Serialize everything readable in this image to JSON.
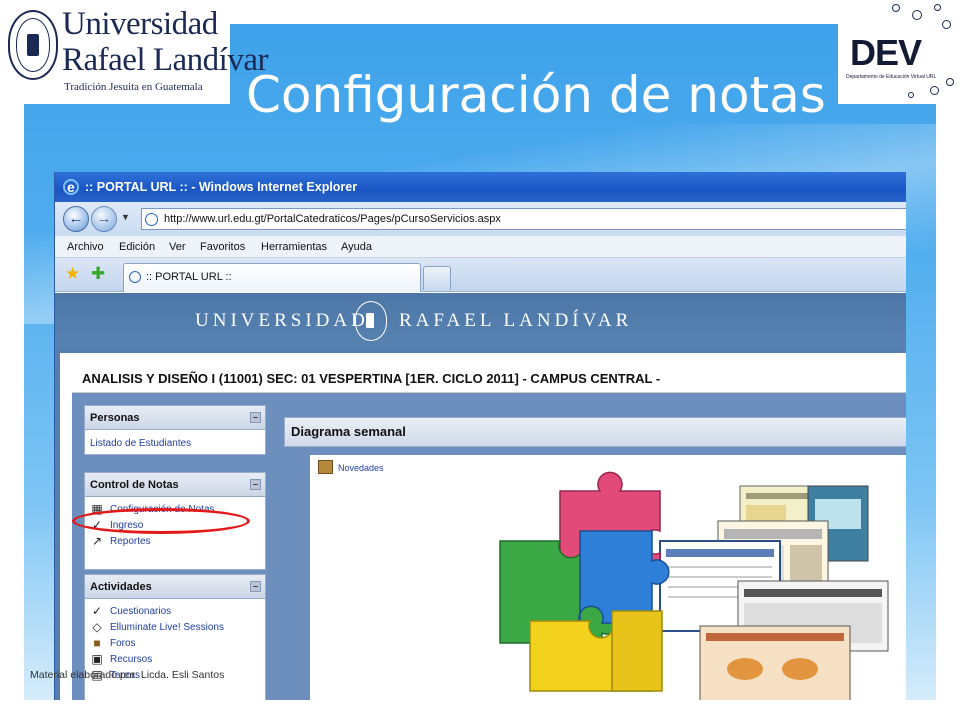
{
  "slide": {
    "title": "Configuración de notas",
    "footer": "Material elaborado por: Licda. Esli Santos"
  },
  "logos": {
    "university": {
      "line1": "Universidad",
      "line2": "Rafael Landívar",
      "tagline": "Tradición Jesuita en Guatemala"
    },
    "dev": {
      "name": "DEV",
      "subtitle": "Departamento de Educación Virtual URL"
    }
  },
  "browser": {
    "window_title": ":: PORTAL URL :: - Windows Internet Explorer",
    "address": "http://www.url.edu.gt/PortalCatedraticos/Pages/pCursoServicios.aspx",
    "menu": [
      "Archivo",
      "Edición",
      "Ver",
      "Favoritos",
      "Herramientas",
      "Ayuda"
    ],
    "tab_title": ":: PORTAL URL ::"
  },
  "portal": {
    "banner": "UNIVERSIDAD",
    "banner2": "RAFAEL LANDÍVAR",
    "course_title": "ANALISIS Y DISEÑO I (11001) SEC: 01 VESPERTINA [1ER. CICLO 2011] - CAMPUS CENTRAL -",
    "personas": {
      "header": "Personas",
      "links": [
        "Listado de Estudiantes"
      ]
    },
    "control_notas": {
      "header": "Control de Notas",
      "links": [
        "Configuración de Notas",
        "Ingreso",
        "Reportes"
      ]
    },
    "actividades": {
      "header": "Actividades",
      "links": [
        "Cuestionarios",
        "Elluminate Live! Sessions",
        "Foros",
        "Recursos",
        "Tareas"
      ]
    },
    "diagram": {
      "header": "Diagrama semanal",
      "link": "Novedades"
    }
  },
  "colors": {
    "slide_blue": "#4eacee",
    "highlight": "#e21a1a",
    "ie_titlebar": "#1a56c4",
    "portal_banner": "#557fae"
  }
}
